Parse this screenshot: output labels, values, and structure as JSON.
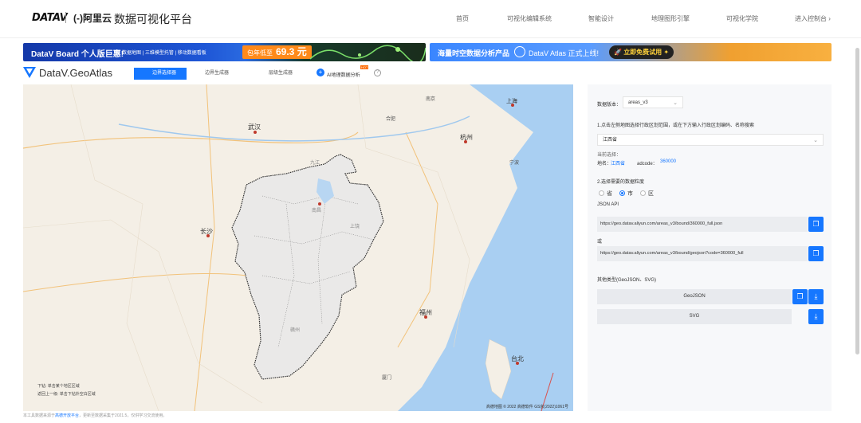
{
  "topnav": {
    "brand": "DATAV",
    "partner": "(-)阿里云",
    "title": "数据可视化平台",
    "items": [
      "首页",
      "可视化编辑系统",
      "智能设计",
      "地理图形引擎",
      "可视化学院",
      "进入控制台 ›"
    ]
  },
  "banners": {
    "left": {
      "title": "DataV Board 个人版巨惠!",
      "subtitle": "数据地图 | 三维模型托管 | 移动数据看板",
      "price_label": "包年低至",
      "price": "69.3 元"
    },
    "right": {
      "title": "海量时空数据分析产品",
      "product": "DataV Atlas  正式上线!",
      "cta": "立即免费试用"
    }
  },
  "geoatlas": {
    "title": "DataV.GeoAtlas",
    "tabs": [
      "边界选择器",
      "边界生成器",
      "层级生成器"
    ],
    "ai_label": "AI地理数据分析",
    "hot_badge": "HOT"
  },
  "map": {
    "legend_line1": "下钻:  单击某个地区区域",
    "legend_line2": "返回上一级:  单击下钻外空白区域",
    "attribution": "高德地图 © 2022 高德软件 GS京(2022)1061号",
    "cities": [
      "武汉",
      "长沙",
      "杭州",
      "上海",
      "福州",
      "台北",
      "南京",
      "合肥",
      "宁波",
      "厦门",
      "赣州",
      "九江",
      "上饶",
      "南昌"
    ]
  },
  "footnote": {
    "prefix": "本工具数据来源于",
    "link": "高德开放平台",
    "suffix": "，更新至数据采集于2021.5，仅供学习交流使用。"
  },
  "panel": {
    "version_label": "数据版本：",
    "version_value": "areas_v3",
    "step1": "1.点击左侧地图选择行政区划范围，或在下方输入行政区划编码、名称搜索",
    "region_select": "江西省",
    "current_label": "当前选择：",
    "name_label": "地名：",
    "name_value": "江西省",
    "adcode_label": "adcode：",
    "adcode_value": "360000",
    "step2": "2.选择需要的数据粒度",
    "radios": [
      "省",
      "市",
      "区"
    ],
    "json_api_label": "JSON API",
    "json_api_url": "https://geo.datav.aliyun.com/areas_v3/bound/360000_full.json",
    "or_label": "或",
    "geojson_url": "https://geo.datav.aliyun.com/areas_v3/bound/geojson?code=360000_full",
    "other_label": "其他类型(GeoJSON、SVG)",
    "geojson_label": "GeoJSON",
    "svg_label": "SVG"
  },
  "colors": {
    "accent": "#1677ff",
    "map_bg": "#f4efe6",
    "sea": "#a9cff2",
    "province_fill": "#e8e8e8"
  }
}
